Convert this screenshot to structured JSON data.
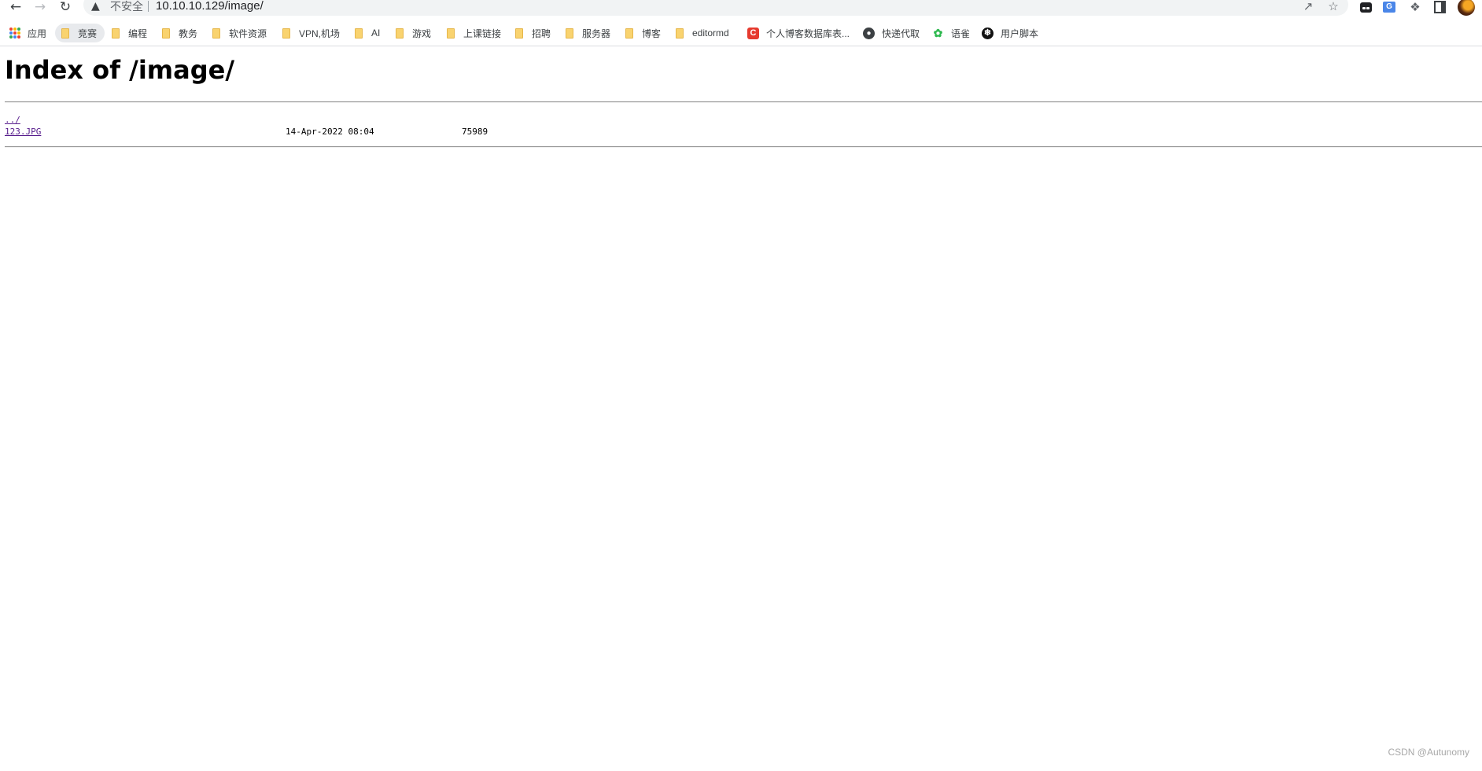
{
  "toolbar": {
    "back_icon": "back-arrow-icon",
    "forward_icon": "forward-arrow-icon",
    "reload_icon": "reload-icon",
    "security_label": "不安全",
    "url": "10.10.10.129/image/",
    "share_icon": "share-icon",
    "star_icon": "star-icon",
    "extensions": [
      "ghost-extension-icon",
      "translate-extension-icon",
      "puzzle-extensions-icon",
      "side-panel-icon"
    ],
    "profile_icon": "avatar"
  },
  "bookmarks": [
    {
      "label": "应用",
      "icon": "apps-grid-icon"
    },
    {
      "label": "竞赛",
      "icon": "folder-icon",
      "active": true
    },
    {
      "label": "编程",
      "icon": "folder-icon"
    },
    {
      "label": "教务",
      "icon": "folder-icon"
    },
    {
      "label": "软件资源",
      "icon": "folder-icon"
    },
    {
      "label": "VPN,机场",
      "icon": "folder-icon"
    },
    {
      "label": "AI",
      "icon": "folder-icon"
    },
    {
      "label": "游戏",
      "icon": "folder-icon"
    },
    {
      "label": "上课链接",
      "icon": "folder-icon"
    },
    {
      "label": "招聘",
      "icon": "folder-icon"
    },
    {
      "label": "服务器",
      "icon": "folder-icon"
    },
    {
      "label": "博客",
      "icon": "folder-icon"
    },
    {
      "label": "editormd",
      "icon": "folder-icon"
    },
    {
      "label": "个人博客数据库表...",
      "icon": "csdn-c-icon"
    },
    {
      "label": "快递代取",
      "icon": "globe-icon"
    },
    {
      "label": "语雀",
      "icon": "yuque-icon"
    },
    {
      "label": "用户脚本",
      "icon": "tampermonkey-icon"
    }
  ],
  "page": {
    "title": "Index of /image/",
    "entries": [
      {
        "name": "../",
        "date": "",
        "size": ""
      },
      {
        "name": "123.JPG",
        "date": "14-Apr-2022 08:04",
        "size": "75989"
      }
    ]
  },
  "watermark": "CSDN @Autunomy",
  "colors": {
    "link": "#551a8b",
    "folder": "#f9d36f",
    "omnibox_bg": "#f1f3f4"
  }
}
